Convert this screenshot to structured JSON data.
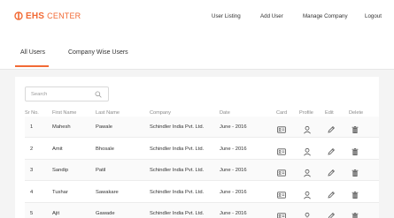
{
  "brand": {
    "strong": "EHS",
    "light": "CENTER",
    "color": "#f26a35"
  },
  "nav": {
    "items": [
      "User Listing",
      "Add User",
      "Manage Company",
      "Logout"
    ]
  },
  "tabs": {
    "items": [
      "All Users",
      "Company Wise Users"
    ],
    "active": "All Users"
  },
  "search": {
    "placeholder": "Search",
    "icon": "search-icon"
  },
  "table": {
    "columns": [
      "Sr No.",
      "First Name",
      "Last Name",
      "Company",
      "Date",
      "Card",
      "Profile",
      "Edit",
      "Delete"
    ],
    "rows": [
      {
        "sr": "1",
        "first": "Mahesh",
        "last": "Pawale",
        "company": "Schindler India Pvt. Ltd.",
        "date": "June - 2016"
      },
      {
        "sr": "2",
        "first": "Amit",
        "last": "Bhosale",
        "company": "Schindler India Pvt. Ltd.",
        "date": "June - 2016"
      },
      {
        "sr": "3",
        "first": "Sandip",
        "last": "Patil",
        "company": "Schindler India Pvt. Ltd.",
        "date": "June - 2016"
      },
      {
        "sr": "4",
        "first": "Tushar",
        "last": "Sawakare",
        "company": "Schindler India Pvt. Ltd.",
        "date": "June - 2016"
      },
      {
        "sr": "5",
        "first": "Ajit",
        "last": "Gawade",
        "company": "Schindler India Pvt. Ltd.",
        "date": "June - 2016"
      }
    ],
    "action_icons": [
      "id-card-icon",
      "user-profile-icon",
      "pencil-edit-icon",
      "trash-delete-icon"
    ]
  }
}
